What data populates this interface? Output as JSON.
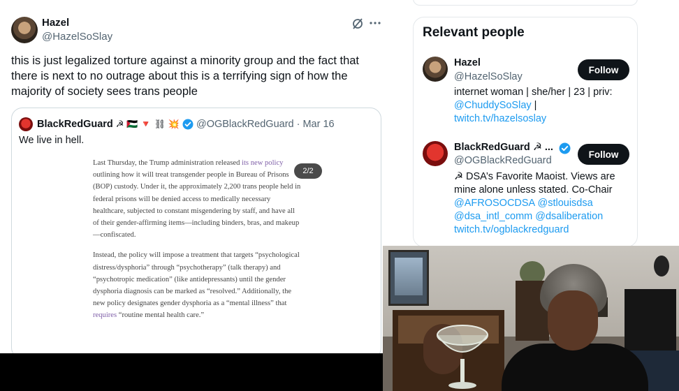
{
  "tweet": {
    "author_name": "Hazel",
    "author_handle": "@HazelSoSlay",
    "text": "this is just legalized torture against a minority group and the fact that there is next to no outrage about this is a terrifying sign of how the majority of society sees trans people",
    "more_icon": "more-dots-icon",
    "grok_icon": "grok-slash-icon"
  },
  "quote": {
    "author_name": "BlackRedGuard",
    "emojis": "☭ 🇵🇸 🔻 ⛓ 💥",
    "verified_icon": "verified-badge-icon",
    "handle": "@OGBlackRedGuard",
    "separator": "·",
    "date": "Mar 16",
    "text": "We live in hell.",
    "image_pager": "2/2",
    "doc_p1_a": "Last Thursday, the Trump administration released ",
    "doc_p1_link": "its new policy",
    "doc_p1_b": " outlining how it will treat transgender people in Bureau of Prisons (BOP) custody. Under it, the approximately 2,200 trans people held in federal prisons will be denied access to medically necessary healthcare, subjected to constant misgendering by staff, and have all of their gender-affirming items—including binders, bras, and makeup—confiscated.",
    "doc_p2_a": "Instead, the policy will impose a treatment that targets “psychological distress/dysphoria” through “psychotherapy” (talk therapy) and “psychotropic medication” (like antidepressants) until the gender dysphoria diagnosis can be marked as “resolved.” Additionally, the new policy designates gender dysphoria as a “mental illness” that ",
    "doc_p2_link": "requires",
    "doc_p2_b": " “routine mental health care.”"
  },
  "sidebar": {
    "title": "Relevant people",
    "people": [
      {
        "name": "Hazel",
        "handle": "@HazelSoSlay",
        "follow_label": "Follow",
        "bio_text": "internet woman | she/her | 23 | priv:",
        "bio_link1": "@ChuddySoSlay",
        "bio_sep": " |",
        "bio_link2": "twitch.tv/hazelsoslay"
      },
      {
        "name": "BlackRedGuard ☭ ...",
        "handle": "@OGBlackRedGuard",
        "follow_label": "Follow",
        "verified_icon": "verified-badge-icon",
        "bio_line1": "☭ DSA’s Favorite Maoist. Views are",
        "bio_line2": "mine alone unless stated. Co-Chair",
        "bio_link1": "@AFROSOCDSA",
        "bio_link2": "@stlouisdsa",
        "bio_link3": "@dsa_intl_comm",
        "bio_link4": "@dsaliberation",
        "bio_link5": "twitch.tv/ogblackredguard"
      }
    ]
  },
  "colors": {
    "accent_blue": "#1d9bf0",
    "text_primary": "#0f1419",
    "text_secondary": "#536471",
    "follow_button": "#0f1419",
    "doc_link": "#7f5fa8"
  }
}
